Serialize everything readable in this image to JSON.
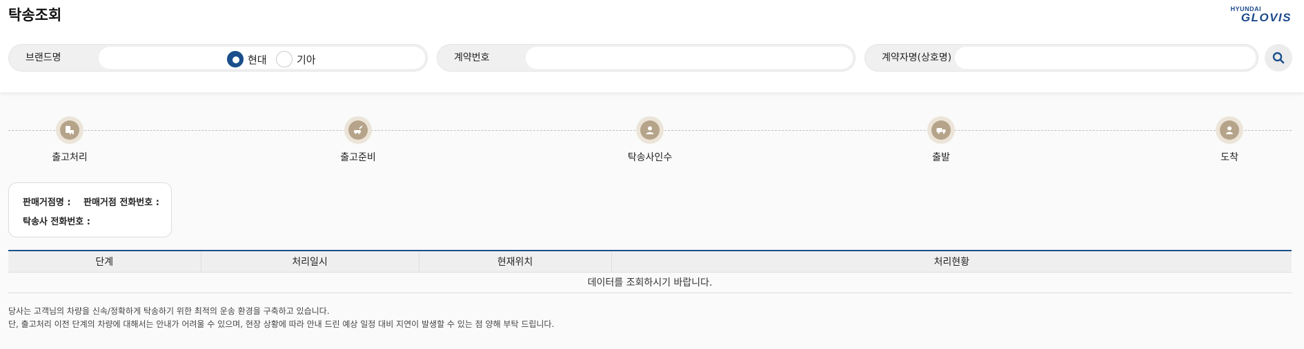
{
  "header": {
    "title": "탁송조회",
    "logo_top": "HYUNDAI",
    "logo_bottom": "GLOVIS"
  },
  "search": {
    "brand_label": "브랜드명",
    "brand_options": [
      {
        "label": "현대",
        "selected": true
      },
      {
        "label": "기아",
        "selected": false
      }
    ],
    "contract_label": "계약번호",
    "contract_value": "",
    "contractor_label": "계약자명(상호명)",
    "contractor_value": "",
    "search_icon": "search-icon"
  },
  "steps": [
    {
      "label": "출고처리",
      "icon": "document-car-icon"
    },
    {
      "label": "출고준비",
      "icon": "car-wash-icon"
    },
    {
      "label": "탁송사인수",
      "icon": "driver-icon"
    },
    {
      "label": "출발",
      "icon": "truck-icon"
    },
    {
      "label": "도착",
      "icon": "person-icon"
    }
  ],
  "info": {
    "dealer_name_label": "판매거점명 :",
    "dealer_phone_label": "판매거점 전화번호 :",
    "carrier_phone_label": "탁송사 전화번호 :"
  },
  "table": {
    "columns": [
      "단계",
      "처리일시",
      "현재위치",
      "처리현황"
    ],
    "empty_message": "데이터를 조회하시기 바랍니다."
  },
  "notice": {
    "line1": "당사는 고객님의 차량을 신속/정확하게 탁송하기 위한 최적의 운송 환경을 구축하고 있습니다.",
    "line2": "단, 출고처리 이전 단계의 차량에 대해서는 안내가 어려울 수 있으며, 현장 상황에 따라 안내 드린 예상 일정 대비 지연이 발생할 수 있는 점 양해 부탁 드립니다."
  },
  "colors": {
    "accent": "#1a4f8b",
    "step_ring": "#ece4d8",
    "step_fill": "#b5a48a"
  }
}
